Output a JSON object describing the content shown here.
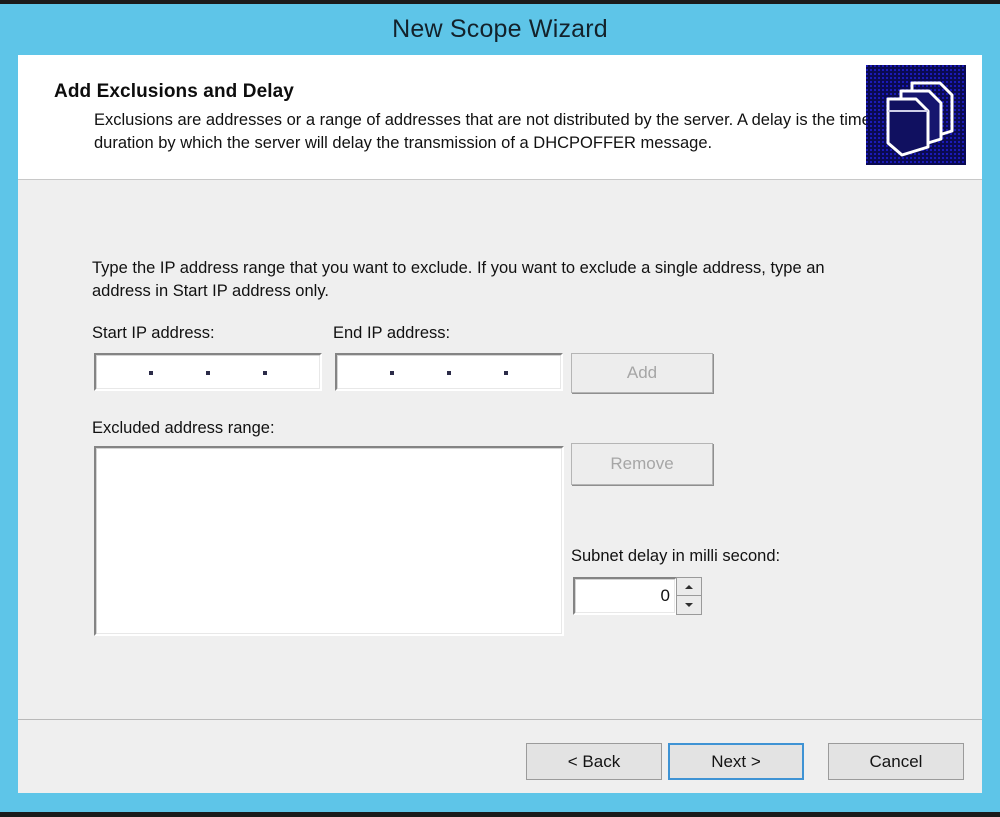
{
  "window": {
    "title": "New Scope Wizard",
    "frame_color": "#5ec5e8",
    "client_bg": "#efefef"
  },
  "header": {
    "title": "Add Exclusions and Delay",
    "description": "Exclusions are addresses or a range of addresses that are not distributed by the server. A delay is the time duration by which the server will delay the transmission of a DHCPOFFER message.",
    "icon": "folders-stack-icon",
    "icon_bg": "#070763"
  },
  "body": {
    "intro": "Type the IP address range that you want to exclude. If you want to exclude a single address, type an address in Start IP address only.",
    "start_ip": {
      "label": "Start IP address:",
      "value": "",
      "octets": [
        "",
        "",
        "",
        ""
      ],
      "separator": "."
    },
    "end_ip": {
      "label": "End IP address:",
      "value": "",
      "octets": [
        "",
        "",
        "",
        ""
      ],
      "separator": "."
    },
    "add_button": {
      "label": "Add",
      "enabled": false
    },
    "excluded_list": {
      "label": "Excluded address range:",
      "items": []
    },
    "remove_button": {
      "label": "Remove",
      "enabled": false
    },
    "subnet_delay": {
      "label": "Subnet delay in milli second:",
      "value": "0",
      "increment_icon": "spinner-up-arrow-icon",
      "decrement_icon": "spinner-down-arrow-icon"
    }
  },
  "footer": {
    "back_label": "< Back",
    "next_label": "Next >",
    "cancel_label": "Cancel",
    "default_button": "next",
    "focus_color": "#3f93d4"
  }
}
